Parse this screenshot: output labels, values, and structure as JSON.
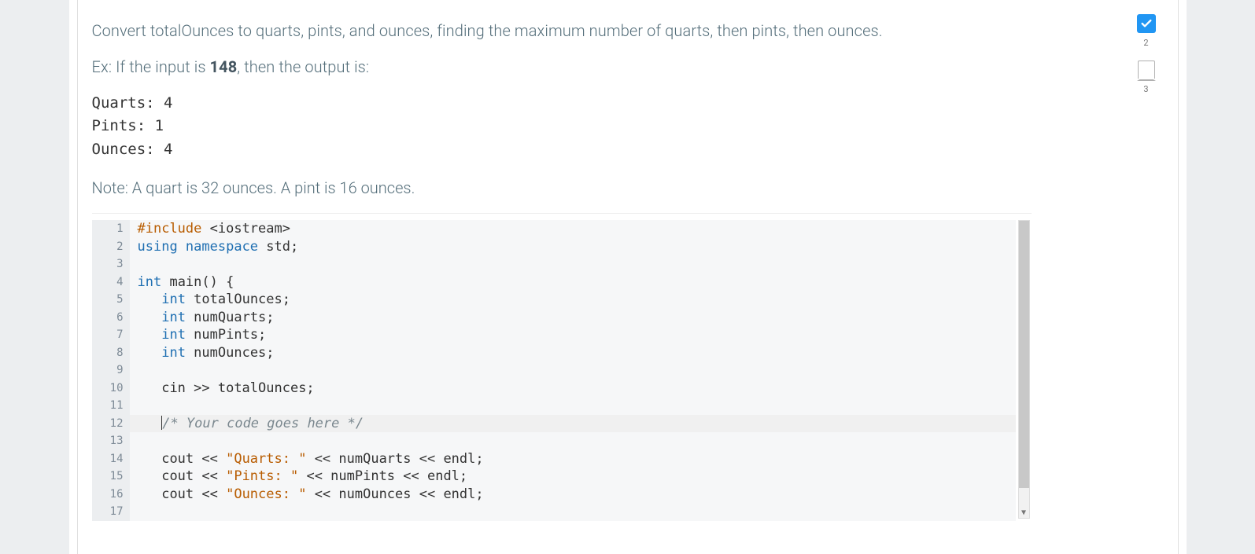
{
  "prompt": {
    "line1_pre": "Convert totalOunces to quarts, pints, and ounces, finding the maximum number of quarts, then pints, then ounces.",
    "line2_pre": "Ex: If the input is ",
    "line2_bold": "148",
    "line2_post": ", then the output is:"
  },
  "example_output": "Quarts: 4\nPints: 1\nOunces: 4",
  "note": "Note: A quart is 32 ounces. A pint is 16 ounces.",
  "badges": {
    "check_count": "2",
    "bookmark_count": "3"
  },
  "code": {
    "active_line": 12,
    "lines": [
      {
        "n": 1,
        "readonly": true,
        "tokens": [
          {
            "t": "#include ",
            "c": "kw-include"
          },
          {
            "t": "<iostream>",
            "c": ""
          }
        ]
      },
      {
        "n": 2,
        "readonly": true,
        "tokens": [
          {
            "t": "using ",
            "c": "kw-blue"
          },
          {
            "t": "namespace ",
            "c": "kw-blue"
          },
          {
            "t": "std;",
            "c": ""
          }
        ]
      },
      {
        "n": 3,
        "readonly": true,
        "tokens": [
          {
            "t": "",
            "c": ""
          }
        ]
      },
      {
        "n": 4,
        "readonly": true,
        "tokens": [
          {
            "t": "int ",
            "c": "type"
          },
          {
            "t": "main",
            "c": "func"
          },
          {
            "t": "() {",
            "c": ""
          }
        ]
      },
      {
        "n": 5,
        "readonly": true,
        "tokens": [
          {
            "t": "   ",
            "c": ""
          },
          {
            "t": "int ",
            "c": "type"
          },
          {
            "t": "totalOunces;",
            "c": ""
          }
        ]
      },
      {
        "n": 6,
        "readonly": true,
        "tokens": [
          {
            "t": "   ",
            "c": ""
          },
          {
            "t": "int ",
            "c": "type"
          },
          {
            "t": "numQuarts;",
            "c": ""
          }
        ]
      },
      {
        "n": 7,
        "readonly": true,
        "tokens": [
          {
            "t": "   ",
            "c": ""
          },
          {
            "t": "int ",
            "c": "type"
          },
          {
            "t": "numPints;",
            "c": ""
          }
        ]
      },
      {
        "n": 8,
        "readonly": true,
        "tokens": [
          {
            "t": "   ",
            "c": ""
          },
          {
            "t": "int ",
            "c": "type"
          },
          {
            "t": "numOunces;",
            "c": ""
          }
        ]
      },
      {
        "n": 9,
        "readonly": true,
        "tokens": [
          {
            "t": "",
            "c": ""
          }
        ]
      },
      {
        "n": 10,
        "readonly": true,
        "tokens": [
          {
            "t": "   cin >> totalOunces;",
            "c": ""
          }
        ]
      },
      {
        "n": 11,
        "readonly": true,
        "tokens": [
          {
            "t": "",
            "c": ""
          }
        ]
      },
      {
        "n": 12,
        "readonly": false,
        "tokens": [
          {
            "t": "   ",
            "c": ""
          },
          {
            "t": "/* Your code goes here */",
            "c": "comment"
          }
        ]
      },
      {
        "n": 13,
        "readonly": true,
        "tokens": [
          {
            "t": "",
            "c": ""
          }
        ]
      },
      {
        "n": 14,
        "readonly": true,
        "tokens": [
          {
            "t": "   cout << ",
            "c": ""
          },
          {
            "t": "\"Quarts: \"",
            "c": "str"
          },
          {
            "t": " << numQuarts << endl;",
            "c": ""
          }
        ]
      },
      {
        "n": 15,
        "readonly": true,
        "tokens": [
          {
            "t": "   cout << ",
            "c": ""
          },
          {
            "t": "\"Pints: \"",
            "c": "str"
          },
          {
            "t": " << numPints << endl;",
            "c": ""
          }
        ]
      },
      {
        "n": 16,
        "readonly": true,
        "tokens": [
          {
            "t": "   cout << ",
            "c": ""
          },
          {
            "t": "\"Ounces: \"",
            "c": "str"
          },
          {
            "t": " << numOunces << endl;",
            "c": ""
          }
        ]
      },
      {
        "n": 17,
        "readonly": true,
        "tokens": [
          {
            "t": "",
            "c": ""
          }
        ]
      }
    ]
  }
}
